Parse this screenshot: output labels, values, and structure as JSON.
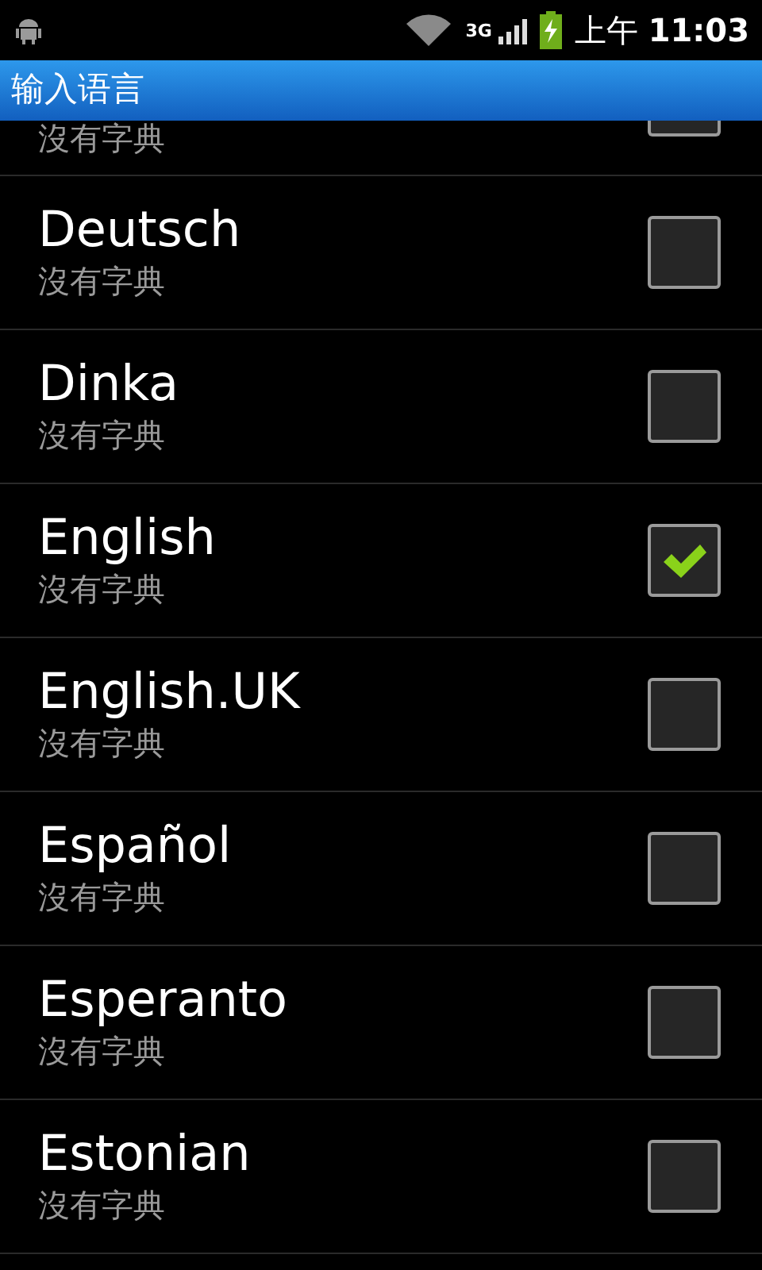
{
  "status_bar": {
    "time_prefix": "上午",
    "time": "11:03",
    "network": "3G"
  },
  "title_bar": {
    "title": "输入语言"
  },
  "languages": [
    {
      "subtitle": "沒有字典",
      "partial": true
    },
    {
      "name": "Deutsch",
      "subtitle": "沒有字典",
      "checked": false
    },
    {
      "name": "Dinka",
      "subtitle": "沒有字典",
      "checked": false
    },
    {
      "name": "English",
      "subtitle": "沒有字典",
      "checked": true
    },
    {
      "name": "English.UK",
      "subtitle": "沒有字典",
      "checked": false
    },
    {
      "name": "Español",
      "subtitle": "沒有字典",
      "checked": false
    },
    {
      "name": "Esperanto",
      "subtitle": "沒有字典",
      "checked": false
    },
    {
      "name": "Estonian",
      "subtitle": "沒有字典",
      "checked": false
    }
  ]
}
